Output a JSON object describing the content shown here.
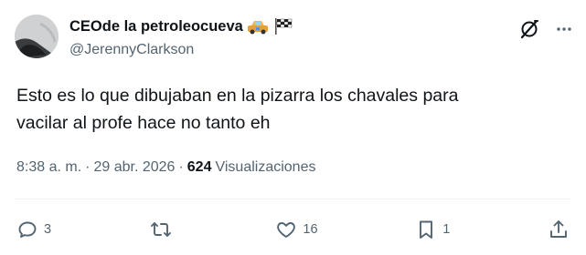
{
  "author": {
    "display_name": "CEOde la petroleocueva",
    "handle": "@JerennyClarkson",
    "emoji_icons": [
      "car-icon",
      "checkered-flag-icon"
    ]
  },
  "tweet": {
    "text": "Esto es lo que dibujaban en la pizarra los chavales para\nvacilar al profe hace no tanto eh",
    "time": "8:38 a. m.",
    "separator": "·",
    "date": "29 abr. 2026",
    "views_count": "624",
    "views_label": "Visualizaciones"
  },
  "actions": {
    "replies": "3",
    "reposts": "",
    "likes": "16",
    "bookmarks": "1"
  },
  "colors": {
    "text": "#0f1419",
    "secondary": "#536471",
    "divider": "#eff3f4"
  }
}
